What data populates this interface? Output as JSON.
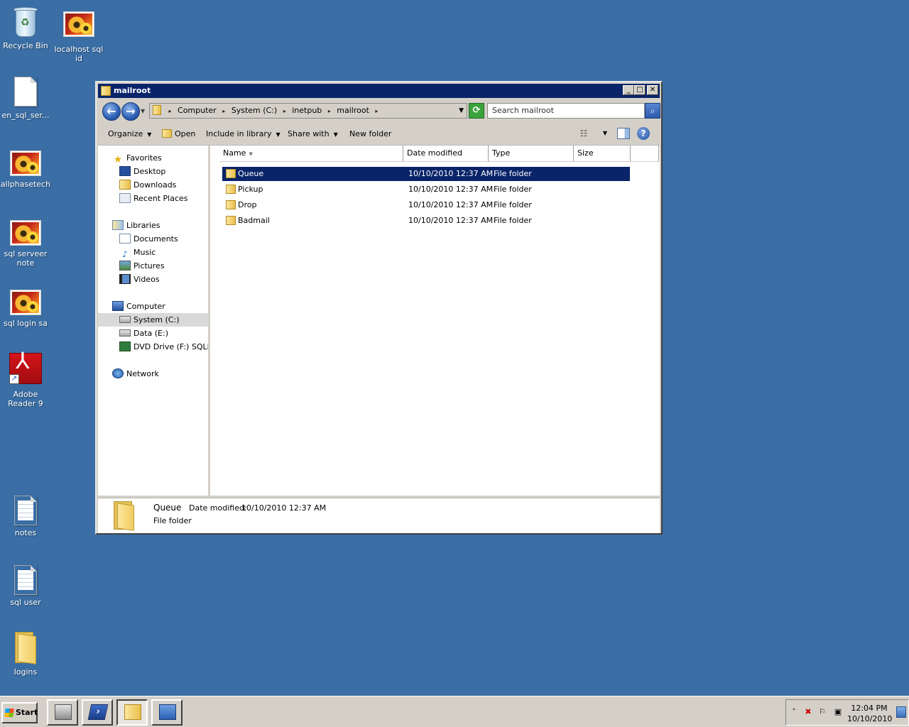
{
  "desktop": {
    "icons": [
      {
        "label": "Recycle Bin"
      },
      {
        "label": "localhost sql id"
      },
      {
        "label": "en_sql_ser..."
      },
      {
        "label": "allphasetech"
      },
      {
        "label": "sql serveer note"
      },
      {
        "label": "sql login sa"
      },
      {
        "label": "Adobe Reader 9"
      },
      {
        "label": "notes"
      },
      {
        "label": "sql user"
      },
      {
        "label": "logins"
      }
    ]
  },
  "window": {
    "title": "mailroot",
    "controls": {
      "minimize": "_",
      "maximize": "□",
      "close": "✕"
    },
    "address": {
      "crumbs": [
        "Computer",
        "System (C:)",
        "inetpub",
        "mailroot"
      ]
    },
    "search": {
      "placeholder": "Search mailroot"
    },
    "commands": {
      "organize": "Organize",
      "open": "Open",
      "include_in_library": "Include in library",
      "share_with": "Share with",
      "new_folder": "New folder"
    },
    "nav": {
      "favorites": "Favorites",
      "desktop": "Desktop",
      "downloads": "Downloads",
      "recent_places": "Recent Places",
      "libraries": "Libraries",
      "documents": "Documents",
      "music": "Music",
      "pictures": "Pictures",
      "videos": "Videos",
      "computer": "Computer",
      "system_c": "System (C:)",
      "data_e": "Data (E:)",
      "dvd_f": "DVD Drive (F:) SQLFULL",
      "network": "Network"
    },
    "columns": {
      "name": "Name",
      "date_modified": "Date modified",
      "type": "Type",
      "size": "Size"
    },
    "rows": [
      {
        "name": "Queue",
        "date": "10/10/2010 12:37 AM",
        "type": "File folder",
        "size": ""
      },
      {
        "name": "Pickup",
        "date": "10/10/2010 12:37 AM",
        "type": "File folder",
        "size": ""
      },
      {
        "name": "Drop",
        "date": "10/10/2010 12:37 AM",
        "type": "File folder",
        "size": ""
      },
      {
        "name": "Badmail",
        "date": "10/10/2010 12:37 AM",
        "type": "File folder",
        "size": ""
      }
    ],
    "details": {
      "name": "Queue",
      "date_label": "Date modified:",
      "date_value": "10/10/2010 12:37 AM",
      "type": "File folder"
    }
  },
  "taskbar": {
    "start_label": "Start",
    "clock_time": "12:04 PM",
    "clock_date": "10/10/2010"
  },
  "colors": {
    "desktop_bg": "#3a6ea5",
    "title_bar": "#0a246a",
    "selection": "#0a246a"
  }
}
